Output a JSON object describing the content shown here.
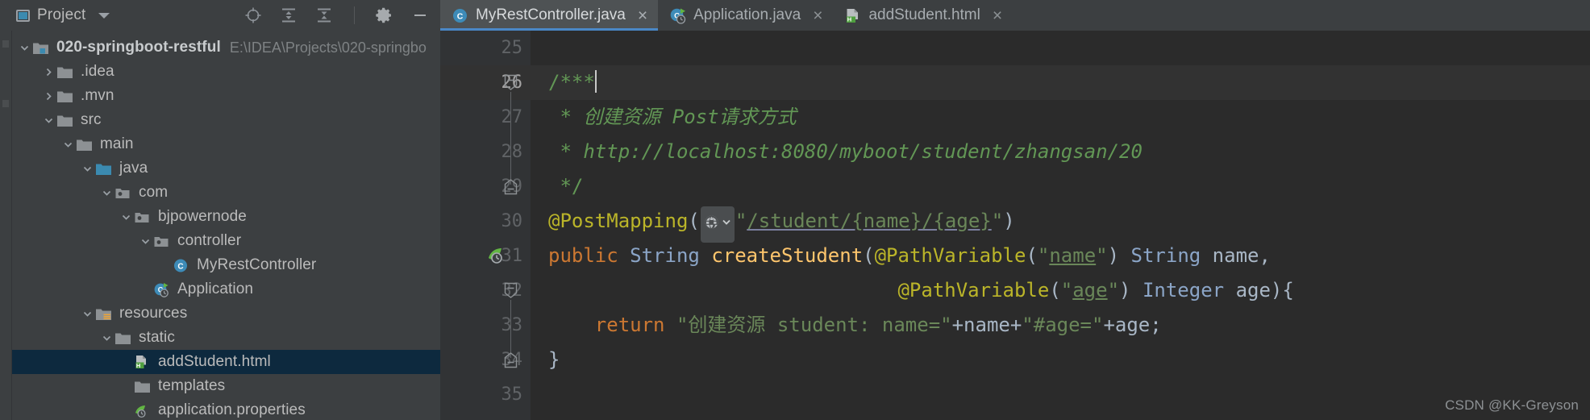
{
  "project_panel": {
    "title": "Project",
    "dropdown_icon": "chevron-down-icon",
    "toolbar": [
      {
        "name": "locate-icon",
        "label": "Select Opened File"
      },
      {
        "name": "collapse-all-icon",
        "label": "Collapse All"
      },
      {
        "name": "expand-all-icon",
        "label": "Expand All"
      },
      {
        "name": "gear-icon",
        "label": "Settings"
      },
      {
        "name": "minimize-icon",
        "label": "Hide"
      }
    ],
    "tree": [
      {
        "label": "020-springboot-restful",
        "path": "E:\\IDEA\\Projects\\020-springbo",
        "depth": 0,
        "arrow": "down",
        "icon": "module-folder",
        "bold": true,
        "selected": false
      },
      {
        "label": ".idea",
        "path": "",
        "depth": 1,
        "arrow": "right",
        "icon": "folder",
        "bold": false,
        "selected": false
      },
      {
        "label": ".mvn",
        "path": "",
        "depth": 1,
        "arrow": "right",
        "icon": "folder",
        "bold": false,
        "selected": false
      },
      {
        "label": "src",
        "path": "",
        "depth": 1,
        "arrow": "down",
        "icon": "folder",
        "bold": false,
        "selected": false
      },
      {
        "label": "main",
        "path": "",
        "depth": 2,
        "arrow": "down",
        "icon": "folder",
        "bold": false,
        "selected": false
      },
      {
        "label": "java",
        "path": "",
        "depth": 3,
        "arrow": "down",
        "icon": "source-folder",
        "bold": false,
        "selected": false
      },
      {
        "label": "com",
        "path": "",
        "depth": 4,
        "arrow": "down",
        "icon": "package",
        "bold": false,
        "selected": false
      },
      {
        "label": "bjpowernode",
        "path": "",
        "depth": 5,
        "arrow": "down",
        "icon": "package",
        "bold": false,
        "selected": false
      },
      {
        "label": "controller",
        "path": "",
        "depth": 6,
        "arrow": "down",
        "icon": "package",
        "bold": false,
        "selected": false
      },
      {
        "label": "MyRestController",
        "path": "",
        "depth": 7,
        "arrow": "none",
        "icon": "java-class",
        "bold": false,
        "selected": false
      },
      {
        "label": "Application",
        "path": "",
        "depth": 6,
        "arrow": "none",
        "icon": "spring-class",
        "bold": false,
        "selected": false
      },
      {
        "label": "resources",
        "path": "",
        "depth": 3,
        "arrow": "down",
        "icon": "resources-folder",
        "bold": false,
        "selected": false
      },
      {
        "label": "static",
        "path": "",
        "depth": 4,
        "arrow": "down",
        "icon": "folder",
        "bold": false,
        "selected": false
      },
      {
        "label": "addStudent.html",
        "path": "",
        "depth": 5,
        "arrow": "none",
        "icon": "html-file",
        "bold": false,
        "selected": true
      },
      {
        "label": "templates",
        "path": "",
        "depth": 4,
        "arrow": "none",
        "icon": "folder",
        "bold": false,
        "selected": false
      },
      {
        "label": "application.properties",
        "path": "",
        "depth": 4,
        "arrow": "none",
        "icon": "spring-properties",
        "bold": false,
        "selected": false
      }
    ]
  },
  "tabs": [
    {
      "label": "MyRestController.java",
      "icon": "java-class",
      "active": true,
      "close": "×"
    },
    {
      "label": "Application.java",
      "icon": "spring-class",
      "active": false,
      "close": "×"
    },
    {
      "label": "addStudent.html",
      "icon": "html-file",
      "active": false,
      "close": "×"
    }
  ],
  "editor": {
    "current_line": 26,
    "lines": [
      {
        "n": "25",
        "fold": "none",
        "spring": false
      },
      {
        "n": "26",
        "fold": "start",
        "spring": false
      },
      {
        "n": "27",
        "fold": "none",
        "spring": false
      },
      {
        "n": "28",
        "fold": "none",
        "spring": false
      },
      {
        "n": "29",
        "fold": "end",
        "spring": false
      },
      {
        "n": "30",
        "fold": "none",
        "spring": false
      },
      {
        "n": "31",
        "fold": "none",
        "spring": true
      },
      {
        "n": "32",
        "fold": "start",
        "spring": false
      },
      {
        "n": "33",
        "fold": "none",
        "spring": false
      },
      {
        "n": "34",
        "fold": "end",
        "spring": false
      },
      {
        "n": "35",
        "fold": "none",
        "spring": false
      }
    ],
    "code": {
      "l25": "",
      "l26_comment": "/***",
      "l27_star": " * ",
      "l27_text": "创建资源 Post请求方式",
      "l28_star": " * ",
      "l28_text": "http://localhost:8080/myboot/student/zhangsan/20",
      "l29_end": " */",
      "l30_ann": "@PostMapping",
      "l30_open": "(",
      "l30_quote1": "\"",
      "l30_path": "/student/{name}/{age}",
      "l30_quote2": "\"",
      "l30_close": ")",
      "l31_kw": "public",
      "l31_type": "String",
      "l31_method": "createStudent",
      "l31_p1_ann": "@PathVariable",
      "l31_p1_arg": "name",
      "l31_p1_type": "String",
      "l31_p1_name": "name,",
      "l32_ann": "@PathVariable",
      "l32_arg": "age",
      "l32_type": "Integer",
      "l32_name": "age){",
      "l33_kw": "return",
      "l33_str": "\"创建资源 student: name=\"",
      "l33_rest": "+name+",
      "l33_str2": "\"#age=\"",
      "l33_rest2": "+age;",
      "l34_brace": "}",
      "l35": ""
    },
    "globe_badge": {
      "icon": "globe-icon",
      "chevron": "chevron-down-icon"
    }
  },
  "watermark": "CSDN @KK-Greyson"
}
